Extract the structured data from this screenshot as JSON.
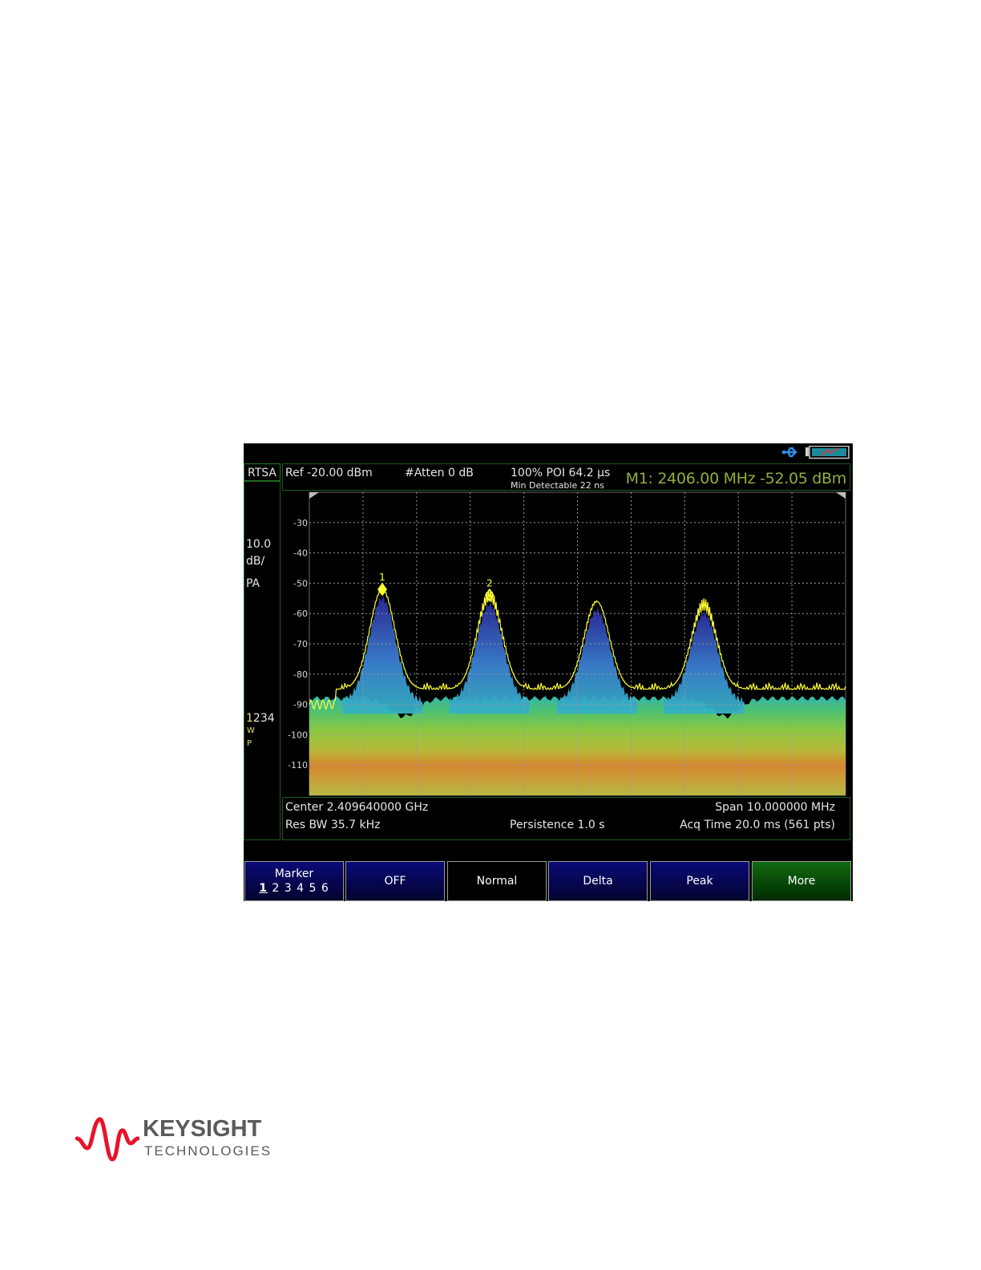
{
  "window": {
    "mode": "RTSA"
  },
  "status": {
    "usb_icon": "usb-icon",
    "battery_icon": "battery-icon"
  },
  "header": {
    "ref_level": "Ref -20.00 dBm",
    "attenuation": "#Atten 0 dB",
    "poi": "100% POI 64.2 µs",
    "min_detectable": "Min Detectable 22 ns",
    "marker_readout": "M1:  2406.00  MHz  -52.05 dBm"
  },
  "left_panel": {
    "scale_value": "10.0",
    "scale_unit": "dB/",
    "detector": "PA",
    "traces": [
      "1",
      "2",
      "3",
      "4"
    ],
    "trace_type": "W",
    "trace_det": "P"
  },
  "footer": {
    "center": "Center 2.409640000 GHz",
    "span": "Span 10.000000 MHz",
    "res_bw": "Res BW 35.7 kHz",
    "persistence": "Persistence 1.0  s",
    "acq_time": "Acq Time 20.0 ms (561 pts)"
  },
  "softkeys": [
    {
      "label": "Marker",
      "sub": [
        "1",
        "2 3 4 5 6"
      ],
      "style": "blue",
      "selected_marker": "1"
    },
    {
      "label": "OFF",
      "style": "blue"
    },
    {
      "label": "Normal",
      "style": "black"
    },
    {
      "label": "Delta",
      "style": "blue"
    },
    {
      "label": "Peak",
      "style": "blue"
    },
    {
      "label": "More",
      "style": "green"
    }
  ],
  "chart_data": {
    "type": "line",
    "y_ticks": [
      "-30",
      "-40",
      "-50",
      "-60",
      "-70",
      "-80",
      "-90",
      "-100",
      "-110"
    ],
    "ylim": [
      -120,
      -20
    ],
    "x_center_ghz": 2.40964,
    "span_mhz": 10,
    "x_range_mhz": [
      2404.64,
      2414.64
    ],
    "grid": true,
    "peaks_mhz": [
      2406.0,
      2408.0,
      2410.0,
      2412.0
    ],
    "peak_levels_dbm": [
      -52,
      -54,
      -56,
      -57
    ],
    "noise_floor_dbm": -85,
    "markers": [
      {
        "label": "1",
        "x_mhz": 2406.0,
        "y_dbm": -52.05
      },
      {
        "label": "2",
        "x_mhz": 2408.0,
        "y_dbm": -54.0
      }
    ],
    "colors": {
      "trace": "#ffff33",
      "marker": "#ffff33",
      "grid": "#9a9a9a",
      "hot": "#d67a2b",
      "warm": "#7ecb3a",
      "cool": "#3aa6c8",
      "cold": "#2a2a9a"
    }
  },
  "brand": {
    "name": "KEYSIGHT",
    "sub": "TECHNOLOGIES",
    "color": "#e8132a"
  }
}
